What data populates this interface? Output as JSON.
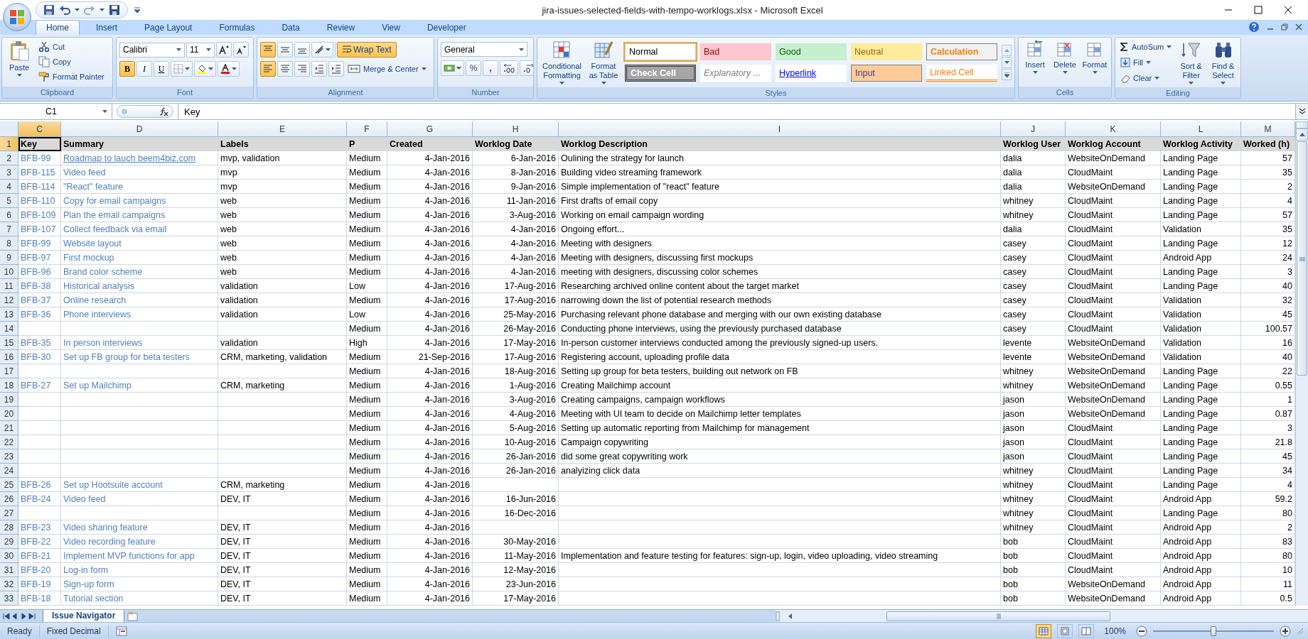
{
  "window": {
    "title": "jira-issues-selected-fields-with-tempo-worklogs.xlsx - Microsoft Excel"
  },
  "ribbon_tabs": [
    {
      "label": "Home",
      "selected": true
    },
    {
      "label": "Insert",
      "selected": false
    },
    {
      "label": "Page Layout",
      "selected": false
    },
    {
      "label": "Formulas",
      "selected": false
    },
    {
      "label": "Data",
      "selected": false
    },
    {
      "label": "Review",
      "selected": false
    },
    {
      "label": "View",
      "selected": false
    },
    {
      "label": "Developer",
      "selected": false
    }
  ],
  "clipboard": {
    "title": "Clipboard",
    "paste": "Paste",
    "cut": "Cut",
    "copy": "Copy",
    "format_painter": "Format Painter"
  },
  "font": {
    "title": "Font",
    "name": "Calibri",
    "size": "11",
    "bold": {
      "label": "B",
      "on": true
    },
    "italic": {
      "label": "I",
      "on": false
    },
    "underline": {
      "label": "U",
      "on": false
    }
  },
  "alignment": {
    "title": "Alignment",
    "vertical": [
      {
        "selected": true
      },
      {
        "selected": false
      },
      {
        "selected": false
      }
    ],
    "horizontal": [
      {
        "selected": true
      },
      {
        "selected": false
      },
      {
        "selected": false
      }
    ],
    "wrap_text": {
      "label": "Wrap Text",
      "on": true
    },
    "merge": "Merge & Center"
  },
  "number": {
    "title": "Number",
    "format": "General",
    "percent": "%",
    "comma": ","
  },
  "styles": {
    "title": "Styles",
    "conditional": "Conditional Formatting",
    "format_table": "Format as Table",
    "gallery": [
      {
        "label": "Normal",
        "kind": "normal",
        "selected": true
      },
      {
        "label": "Bad",
        "kind": "bad",
        "selected": false
      },
      {
        "label": "Good",
        "kind": "good",
        "selected": false
      },
      {
        "label": "Neutral",
        "kind": "neutral",
        "selected": false
      },
      {
        "label": "Calculation",
        "kind": "calculation",
        "selected": false
      },
      {
        "label": "Check Cell",
        "kind": "check",
        "selected": false
      },
      {
        "label": "Explanatory ...",
        "kind": "explanatory",
        "selected": false
      },
      {
        "label": "Hyperlink",
        "kind": "hyperlink",
        "selected": false
      },
      {
        "label": "Input",
        "kind": "input",
        "selected": false
      },
      {
        "label": "Linked Cell",
        "kind": "linked",
        "selected": false
      }
    ]
  },
  "cells_group": {
    "title": "Cells",
    "insert": "Insert",
    "delete": "Delete",
    "format": "Format"
  },
  "editing": {
    "title": "Editing",
    "autosum": "AutoSum",
    "fill": "Fill",
    "clear": "Clear",
    "sort": "Sort & Filter",
    "find": "Find & Select"
  },
  "formula_bar": {
    "name_box": "C1",
    "formula": "Key"
  },
  "table": {
    "columns": [
      {
        "letter": "C",
        "selected": true
      },
      {
        "letter": "D",
        "selected": false
      },
      {
        "letter": "E",
        "selected": false
      },
      {
        "letter": "F",
        "selected": false
      },
      {
        "letter": "G",
        "selected": false
      },
      {
        "letter": "H",
        "selected": false
      },
      {
        "letter": "I",
        "selected": false
      },
      {
        "letter": "J",
        "selected": false
      },
      {
        "letter": "K",
        "selected": false
      },
      {
        "letter": "L",
        "selected": false
      },
      {
        "letter": "M",
        "selected": false
      }
    ],
    "header_row": {
      "n": "1",
      "selected": true,
      "key": "Key",
      "summary": "Summary",
      "labels": "Labels",
      "p": "P",
      "created": "Created",
      "date": "Worklog Date",
      "desc": "Worklog Description",
      "user": "Worklog User",
      "account": "Worklog Account",
      "activity": "Worklog Activity",
      "worked": "Worked (h)"
    },
    "rows": [
      {
        "n": "2",
        "selected": false,
        "underlined": true,
        "key": "BFB-99",
        "summary": "Roadmap to lauch beem4biz.com",
        "labels": "mvp, validation",
        "p": "Medium",
        "created": "4-Jan-2016",
        "date": "6-Jan-2016",
        "desc": "Oulining the strategy for launch",
        "user": "dalia",
        "account": "WebsiteOnDemand",
        "activity": "Landing Page",
        "worked": "57"
      },
      {
        "n": "3",
        "selected": false,
        "underlined": false,
        "key": "BFB-115",
        "summary": "Video feed",
        "labels": "mvp",
        "p": "Medium",
        "created": "4-Jan-2016",
        "date": "8-Jan-2016",
        "desc": "Building video streaming framework",
        "user": "dalia",
        "account": "CloudMaint",
        "activity": "Landing Page",
        "worked": "35"
      },
      {
        "n": "4",
        "selected": false,
        "underlined": false,
        "key": "BFB-114",
        "summary": "\"React\" feature",
        "labels": "mvp",
        "p": "Medium",
        "created": "4-Jan-2016",
        "date": "9-Jan-2016",
        "desc": "Simple implementation of \"react\" feature",
        "user": "dalia",
        "account": "WebsiteOnDemand",
        "activity": "Landing Page",
        "worked": "2"
      },
      {
        "n": "5",
        "selected": false,
        "underlined": false,
        "key": "BFB-110",
        "summary": "Copy for email campaigns",
        "labels": "web",
        "p": "Medium",
        "created": "4-Jan-2016",
        "date": "11-Jan-2016",
        "desc": "First drafts of email copy",
        "user": "whitney",
        "account": "CloudMaint",
        "activity": "Landing Page",
        "worked": "4"
      },
      {
        "n": "6",
        "selected": false,
        "underlined": false,
        "key": "BFB-109",
        "summary": "Plan the email campaigns",
        "labels": "web",
        "p": "Medium",
        "created": "4-Jan-2016",
        "date": "3-Aug-2016",
        "desc": "Working on email campaign wording",
        "user": "whitney",
        "account": "CloudMaint",
        "activity": "Landing Page",
        "worked": "57"
      },
      {
        "n": "7",
        "selected": false,
        "underlined": false,
        "key": "BFB-107",
        "summary": "Collect feedback via email",
        "labels": "web",
        "p": "Medium",
        "created": "4-Jan-2016",
        "date": "4-Jan-2016",
        "desc": "Ongoing effort...",
        "user": "dalia",
        "account": "CloudMaint",
        "activity": "Validation",
        "worked": "35"
      },
      {
        "n": "8",
        "selected": false,
        "underlined": false,
        "key": "BFB-99",
        "summary": "Website layout",
        "labels": "web",
        "p": "Medium",
        "created": "4-Jan-2016",
        "date": "4-Jan-2016",
        "desc": "Meeting with designers",
        "user": "casey",
        "account": "CloudMaint",
        "activity": "Landing Page",
        "worked": "12"
      },
      {
        "n": "9",
        "selected": false,
        "underlined": false,
        "key": "BFB-97",
        "summary": "First mockup",
        "labels": "web",
        "p": "Medium",
        "created": "4-Jan-2016",
        "date": "4-Jan-2016",
        "desc": "Meeting with designers, discussing first mockups",
        "user": "casey",
        "account": "CloudMaint",
        "activity": "Android App",
        "worked": "24"
      },
      {
        "n": "10",
        "selected": false,
        "underlined": false,
        "key": "BFB-96",
        "summary": "Brand color scheme",
        "labels": "web",
        "p": "Medium",
        "created": "4-Jan-2016",
        "date": "4-Jan-2016",
        "desc": "meeting with designers, discussing color schemes",
        "user": "casey",
        "account": "CloudMaint",
        "activity": "Landing Page",
        "worked": "3"
      },
      {
        "n": "11",
        "selected": false,
        "underlined": false,
        "key": "BFB-38",
        "summary": "Historical analysis",
        "labels": "validation",
        "p": "Low",
        "created": "4-Jan-2016",
        "date": "17-Aug-2016",
        "desc": "Researching archived online content about the target market",
        "user": "casey",
        "account": "CloudMaint",
        "activity": "Landing Page",
        "worked": "40"
      },
      {
        "n": "12",
        "selected": false,
        "underlined": false,
        "key": "BFB-37",
        "summary": "Online research",
        "labels": "validation",
        "p": "Medium",
        "created": "4-Jan-2016",
        "date": "17-Aug-2016",
        "desc": "narrowing down the list of potential research methods",
        "user": "casey",
        "account": "CloudMaint",
        "activity": "Validation",
        "worked": "32"
      },
      {
        "n": "13",
        "selected": false,
        "underlined": false,
        "key": "BFB-36",
        "summary": "Phone interviews",
        "labels": "validation",
        "p": "Low",
        "created": "4-Jan-2016",
        "date": "25-May-2016",
        "desc": "Purchasing relevant phone database and merging with our own existing database",
        "user": "casey",
        "account": "CloudMaint",
        "activity": "Validation",
        "worked": "45"
      },
      {
        "n": "14",
        "selected": false,
        "underlined": false,
        "p": "Medium",
        "created": "4-Jan-2016",
        "date": "26-May-2016",
        "desc": "Conducting phone interviews, using the previously purchased database",
        "user": "casey",
        "account": "CloudMaint",
        "activity": "Validation",
        "worked": "100.57"
      },
      {
        "n": "15",
        "selected": false,
        "underlined": false,
        "key": "BFB-35",
        "summary": "In person interviews",
        "labels": "validation",
        "p": "High",
        "created": "4-Jan-2016",
        "date": "17-May-2016",
        "desc": "In-person customer interviews conducted among the previously signed-up users.",
        "user": "levente",
        "account": "WebsiteOnDemand",
        "activity": "Validation",
        "worked": "16"
      },
      {
        "n": "16",
        "selected": false,
        "underlined": false,
        "key": "BFB-30",
        "summary": "Set up FB group for beta testers",
        "labels": "CRM, marketing, validation",
        "p": "Medium",
        "created": "21-Sep-2016",
        "date": "17-Aug-2016",
        "desc": "Registering account, uploading profile data",
        "user": "levente",
        "account": "WebsiteOnDemand",
        "activity": "Validation",
        "worked": "40"
      },
      {
        "n": "17",
        "selected": false,
        "underlined": false,
        "p": "Medium",
        "created": "4-Jan-2016",
        "date": "18-Aug-2016",
        "desc": "Setting up group for beta testers, building out network on FB",
        "user": "whitney",
        "account": "WebsiteOnDemand",
        "activity": "Landing Page",
        "worked": "22"
      },
      {
        "n": "18",
        "selected": false,
        "underlined": false,
        "key": "BFB-27",
        "summary": "Set up Mailchimp",
        "labels": "CRM, marketing",
        "p": "Medium",
        "created": "4-Jan-2016",
        "date": "1-Aug-2016",
        "desc": "Creating Mailchimp account",
        "user": "whitney",
        "account": "WebsiteOnDemand",
        "activity": "Landing Page",
        "worked": "0.55"
      },
      {
        "n": "19",
        "selected": false,
        "underlined": false,
        "p": "Medium",
        "created": "4-Jan-2016",
        "date": "3-Aug-2016",
        "desc": "Creating campaigns, campaign workflows",
        "user": "jason",
        "account": "WebsiteOnDemand",
        "activity": "Landing Page",
        "worked": "1"
      },
      {
        "n": "20",
        "selected": false,
        "underlined": false,
        "p": "Medium",
        "created": "4-Jan-2016",
        "date": "4-Aug-2016",
        "desc": "Meeting with UI team to decide on Mailchimp letter templates",
        "user": "jason",
        "account": "WebsiteOnDemand",
        "activity": "Landing Page",
        "worked": "0.87"
      },
      {
        "n": "21",
        "selected": false,
        "underlined": false,
        "p": "Medium",
        "created": "4-Jan-2016",
        "date": "5-Aug-2016",
        "desc": "Setting up automatic reporting from Mailchimp for management",
        "user": "jason",
        "account": "CloudMaint",
        "activity": "Landing Page",
        "worked": "3"
      },
      {
        "n": "22",
        "selected": false,
        "underlined": false,
        "p": "Medium",
        "created": "4-Jan-2016",
        "date": "10-Aug-2016",
        "desc": "Campaign copywriting",
        "user": "jason",
        "account": "CloudMaint",
        "activity": "Landing Page",
        "worked": "21.8"
      },
      {
        "n": "23",
        "selected": false,
        "underlined": false,
        "p": "Medium",
        "created": "4-Jan-2016",
        "date": "26-Jan-2016",
        "desc": "did some great copywriting work",
        "user": "jason",
        "account": "CloudMaint",
        "activity": "Landing Page",
        "worked": "45"
      },
      {
        "n": "24",
        "selected": false,
        "underlined": false,
        "p": "Medium",
        "created": "4-Jan-2016",
        "date": "26-Jan-2016",
        "desc": "analyizing click data",
        "user": "whitney",
        "account": "CloudMaint",
        "activity": "Landing Page",
        "worked": "34"
      },
      {
        "n": "25",
        "selected": false,
        "underlined": false,
        "key": "BFB-26",
        "summary": "Set up Hootsuite account",
        "labels": "CRM, marketing",
        "p": "Medium",
        "created": "4-Jan-2016",
        "user": "whitney",
        "account": "CloudMaint",
        "activity": "Landing Page",
        "worked": "4"
      },
      {
        "n": "26",
        "selected": false,
        "underlined": false,
        "key": "BFB-24",
        "summary": "Video feed",
        "labels": "DEV, IT",
        "p": "Medium",
        "created": "4-Jan-2016",
        "date": "16-Jun-2016",
        "user": "whitney",
        "account": "CloudMaint",
        "activity": "Android App",
        "worked": "59.2"
      },
      {
        "n": "27",
        "selected": false,
        "underlined": false,
        "p": "Medium",
        "created": "4-Jan-2016",
        "date": "16-Dec-2016",
        "user": "whitney",
        "account": "CloudMaint",
        "activity": "Landing Page",
        "worked": "80"
      },
      {
        "n": "28",
        "selected": false,
        "underlined": false,
        "key": "BFB-23",
        "summary": "Video sharing feature",
        "labels": "DEV, IT",
        "p": "Medium",
        "created": "4-Jan-2016",
        "user": "whitney",
        "account": "CloudMaint",
        "activity": "Android App",
        "worked": "2"
      },
      {
        "n": "29",
        "selected": false,
        "underlined": false,
        "key": "BFB-22",
        "summary": "Video recording feature",
        "labels": "DEV, IT",
        "p": "Medium",
        "created": "4-Jan-2016",
        "date": "30-May-2016",
        "user": "bob",
        "account": "CloudMaint",
        "activity": "Android App",
        "worked": "83"
      },
      {
        "n": "30",
        "selected": false,
        "underlined": false,
        "key": "BFB-21",
        "summary": "Implement MVP functions for app",
        "labels": "DEV, IT",
        "p": "Medium",
        "created": "4-Jan-2016",
        "date": "11-May-2016",
        "desc": "Implementation and feature testing for features: sign-up, login, video uploading, video streaming",
        "user": "bob",
        "account": "CloudMaint",
        "activity": "Android App",
        "worked": "80"
      },
      {
        "n": "31",
        "selected": false,
        "underlined": false,
        "key": "BFB-20",
        "summary": "Log-in form",
        "labels": "DEV, IT",
        "p": "Medium",
        "created": "4-Jan-2016",
        "date": "12-May-2016",
        "user": "bob",
        "account": "CloudMaint",
        "activity": "Android App",
        "worked": "10"
      },
      {
        "n": "32",
        "selected": false,
        "underlined": false,
        "key": "BFB-19",
        "summary": "Sign-up form",
        "labels": "DEV, IT",
        "p": "Medium",
        "created": "4-Jan-2016",
        "date": "23-Jun-2016",
        "user": "bob",
        "account": "WebsiteOnDemand",
        "activity": "Android App",
        "worked": "11"
      },
      {
        "n": "33",
        "selected": false,
        "underlined": false,
        "key": "BFB-18",
        "summary": "Tutorial section",
        "labels": "DEV, IT",
        "p": "Medium",
        "created": "4-Jan-2016",
        "date": "17-May-2016",
        "user": "bob",
        "account": "WebsiteOnDemand",
        "activity": "Android App",
        "worked": "0.5"
      }
    ]
  },
  "sheet_tabs": [
    {
      "label": "Issue Navigator",
      "selected": true
    }
  ],
  "status_bar": {
    "mode": "Ready",
    "fixed_decimal": "Fixed Decimal",
    "views": [
      {
        "selected": true
      },
      {
        "selected": false
      },
      {
        "selected": false
      }
    ],
    "zoom": "100%",
    "zoom_level": {
      "level": 0.5
    }
  }
}
